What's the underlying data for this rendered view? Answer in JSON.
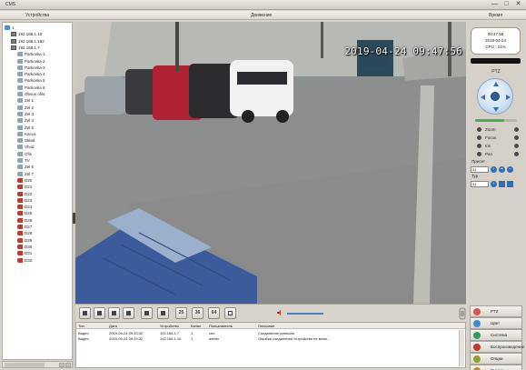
{
  "window": {
    "title": "CMS",
    "controls": [
      "—",
      "□",
      "✕"
    ]
  },
  "headers": {
    "devices": "Устройства",
    "events": "Движение",
    "time": "Время"
  },
  "tree": {
    "items": [
      {
        "label": "1",
        "type": "folder",
        "indent": 0
      },
      {
        "label": "192.168.1.10",
        "type": "dvr",
        "indent": 1
      },
      {
        "label": "192.168.1.182",
        "type": "dvr",
        "indent": 1
      },
      {
        "label": "192.168.1.7",
        "type": "dvr",
        "indent": 1
      },
      {
        "label": "Parkovka 1",
        "type": "cam",
        "indent": 2
      },
      {
        "label": "Parkovka 2",
        "type": "cam",
        "indent": 2
      },
      {
        "label": "Parkovka 3",
        "type": "cam",
        "indent": 2
      },
      {
        "label": "Parkovka 4",
        "type": "cam",
        "indent": 2
      },
      {
        "label": "Parkovka 5",
        "type": "cam",
        "indent": 2
      },
      {
        "label": "Parkovka 6",
        "type": "cam",
        "indent": 2
      },
      {
        "label": "Obsus ofiis",
        "type": "cam",
        "indent": 2
      },
      {
        "label": "Zel 1",
        "type": "cam",
        "indent": 2
      },
      {
        "label": "Zel 2",
        "type": "cam",
        "indent": 2
      },
      {
        "label": "Zel 3",
        "type": "cam",
        "indent": 2
      },
      {
        "label": "Zel 4",
        "type": "cam",
        "indent": 2
      },
      {
        "label": "Zel 5",
        "type": "cam",
        "indent": 2
      },
      {
        "label": "Kacca",
        "type": "cam",
        "indent": 2
      },
      {
        "label": "Sklad",
        "type": "cam",
        "indent": 2
      },
      {
        "label": "Vhod",
        "type": "cam",
        "indent": 2
      },
      {
        "label": "Ofis",
        "type": "cam",
        "indent": 2
      },
      {
        "label": "TV",
        "type": "cam",
        "indent": 2
      },
      {
        "label": "Zel 6",
        "type": "cam",
        "indent": 2
      },
      {
        "label": "Zel 7",
        "type": "cam",
        "indent": 2
      },
      {
        "label": "D20",
        "type": "cam-off",
        "indent": 2
      },
      {
        "label": "D21",
        "type": "cam-off",
        "indent": 2
      },
      {
        "label": "D22",
        "type": "cam-off",
        "indent": 2
      },
      {
        "label": "D23",
        "type": "cam-off",
        "indent": 2
      },
      {
        "label": "D24",
        "type": "cam-off",
        "indent": 2
      },
      {
        "label": "D25",
        "type": "cam-off",
        "indent": 2
      },
      {
        "label": "D26",
        "type": "cam-off",
        "indent": 2
      },
      {
        "label": "D27",
        "type": "cam-off",
        "indent": 2
      },
      {
        "label": "D28",
        "type": "cam-off",
        "indent": 2
      },
      {
        "label": "D29",
        "type": "cam-off",
        "indent": 2
      },
      {
        "label": "D30",
        "type": "cam-off",
        "indent": 2
      },
      {
        "label": "D31",
        "type": "cam-off",
        "indent": 2
      },
      {
        "label": "D32",
        "type": "cam-off",
        "indent": 2
      }
    ]
  },
  "video": {
    "osd_timestamp": "2019-04-24 09:47:56"
  },
  "clock": {
    "time": "09:47:58",
    "date": "2019-04-24",
    "cpu": "CPU : 21%"
  },
  "ptz": {
    "title": "PTZ",
    "speed_level": 0.7,
    "rows": [
      {
        "label": "Zoom"
      },
      {
        "label": "Focus"
      },
      {
        "label": "Iris"
      },
      {
        "label": "Pan"
      }
    ],
    "preset_label": "Пресет",
    "preset_value": "01",
    "tour_label": "Тур",
    "tour_value": "01"
  },
  "toolbar": {
    "buttons": [
      "",
      "",
      "",
      "",
      "",
      "",
      "25",
      "36",
      "64",
      ""
    ]
  },
  "log": {
    "columns": [
      "Тип",
      "Дата",
      "Устройство",
      "Канал",
      "Пользователь",
      "Описание"
    ],
    "rows": [
      [
        "Видео",
        "2019-04-24 09:33:32",
        "192.168.1.7",
        "1",
        "ceo",
        "Соединение успешно"
      ],
      [
        "Видео",
        "2019-04-24 09:33:32",
        "192.168.1.10",
        "1",
        "admin",
        "Ошибка соединения Устройство не вклю..."
      ]
    ]
  },
  "menu": {
    "items": [
      {
        "label": "PTZ",
        "color": "#d9534f"
      },
      {
        "label": "Цвет",
        "color": "#3b8ad9"
      },
      {
        "label": "Система",
        "color": "#2e9e57"
      },
      {
        "label": "Воспроизведение",
        "color": "#c0392b"
      },
      {
        "label": "Опции",
        "color": "#8aa62b"
      },
      {
        "label": "Выход",
        "color": "#c98a1f"
      }
    ]
  }
}
